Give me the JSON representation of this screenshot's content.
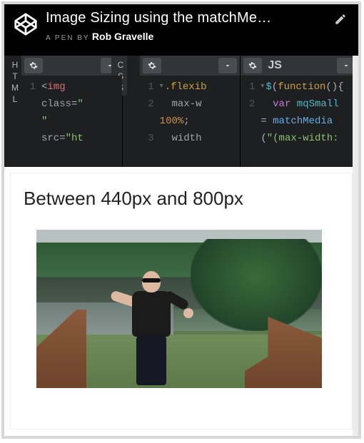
{
  "header": {
    "title": "Image Sizing using the matchMe…",
    "a_pen_by": "A Pen by",
    "author": "Rob Gravelle"
  },
  "panels": {
    "html": {
      "label": "HTML",
      "lines": [
        {
          "n": "1",
          "tokens": [
            {
              "t": "<",
              "c": "tok-punc"
            },
            {
              "t": "img",
              "c": "tok-tag"
            }
          ]
        },
        {
          "n": "",
          "tokens": [
            {
              "t": "class",
              "c": "tok-attr"
            },
            {
              "t": "=",
              "c": "tok-punc"
            },
            {
              "t": "\"",
              "c": "tok-str"
            }
          ]
        },
        {
          "n": "",
          "tokens": [
            {
              "t": "\"",
              "c": "tok-str"
            }
          ]
        },
        {
          "n": "",
          "tokens": [
            {
              "t": "src",
              "c": "tok-attr"
            },
            {
              "t": "=",
              "c": "tok-punc"
            },
            {
              "t": "\"ht",
              "c": "tok-str"
            }
          ]
        }
      ]
    },
    "css": {
      "label": "CSS",
      "lines": [
        {
          "n": "1",
          "fold": true,
          "tokens": [
            {
              "t": ".flexib",
              "c": "tok-sel"
            }
          ]
        },
        {
          "n": "2",
          "tokens": [
            {
              "t": "  max-w",
              "c": "tok-prop"
            }
          ]
        },
        {
          "n": "",
          "tokens": [
            {
              "t": "100%",
              "c": "tok-num"
            },
            {
              "t": ";",
              "c": "tok-punc"
            }
          ]
        },
        {
          "n": "3",
          "tokens": [
            {
              "t": "  width",
              "c": "tok-prop"
            }
          ]
        }
      ]
    },
    "js": {
      "label": "JS",
      "lines": [
        {
          "n": "1",
          "fold": true,
          "tokens": [
            {
              "t": "$",
              "c": "tok-var"
            },
            {
              "t": "(",
              "c": "tok-punc"
            },
            {
              "t": "function",
              "c": "tok-fn"
            },
            {
              "t": "()",
              "c": "tok-punc"
            },
            {
              "t": "{",
              "c": "tok-punc"
            }
          ]
        },
        {
          "n": "2",
          "tokens": [
            {
              "t": "  ",
              "c": ""
            },
            {
              "t": "var",
              "c": "tok-kw"
            },
            {
              "t": " ",
              "c": ""
            },
            {
              "t": "mqSmall",
              "c": "tok-var"
            }
          ]
        },
        {
          "n": "",
          "tokens": [
            {
              "t": "= ",
              "c": "tok-punc"
            },
            {
              "t": "matchMedia",
              "c": "tok-call"
            }
          ]
        },
        {
          "n": "",
          "tokens": [
            {
              "t": "(",
              "c": "tok-punc"
            },
            {
              "t": "\"(max-width:",
              "c": "tok-str"
            }
          ]
        }
      ]
    }
  },
  "output": {
    "heading": "Between 440px and 800px"
  }
}
